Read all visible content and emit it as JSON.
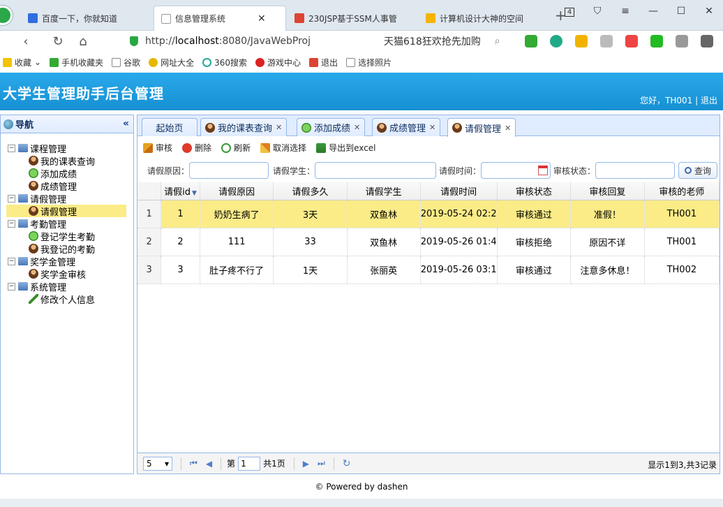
{
  "browser": {
    "tabs": [
      {
        "label": "百度一下，你就知道"
      },
      {
        "label": "信息管理系统"
      },
      {
        "label": "230JSP基于SSM人事管"
      },
      {
        "label": "计算机设计大神的空间"
      }
    ],
    "tab_count": "4",
    "url_prefix": "http://",
    "url_host": "localhost",
    "url_rest": ":8080/JavaWebProj",
    "search_text": "天猫618狂欢抢先加购",
    "bookmarks": [
      {
        "label": "收藏"
      },
      {
        "label": "手机收藏夹"
      },
      {
        "label": "谷歌"
      },
      {
        "label": "网址大全"
      },
      {
        "label": "360搜索"
      },
      {
        "label": "游戏中心"
      },
      {
        "label": "退出"
      },
      {
        "label": "选择照片"
      }
    ]
  },
  "header": {
    "title": "大学生管理助手后台管理",
    "welcome": "您好，TH001 | 退出"
  },
  "nav": {
    "title": "导航",
    "groups": [
      {
        "label": "课程管理",
        "children": [
          {
            "label": "我的课表查询"
          },
          {
            "label": "添加成绩"
          },
          {
            "label": "成绩管理"
          }
        ]
      },
      {
        "label": "请假管理",
        "children": [
          {
            "label": "请假管理"
          }
        ]
      },
      {
        "label": "考勤管理",
        "children": [
          {
            "label": "登记学生考勤"
          },
          {
            "label": "我登记的考勤"
          }
        ]
      },
      {
        "label": "奖学金管理",
        "children": [
          {
            "label": "奖学金审核"
          }
        ]
      },
      {
        "label": "系统管理",
        "children": [
          {
            "label": "修改个人信息"
          }
        ]
      }
    ]
  },
  "tabs": [
    {
      "label": "起始页"
    },
    {
      "label": "我的课表查询"
    },
    {
      "label": "添加成绩"
    },
    {
      "label": "成绩管理"
    },
    {
      "label": "请假管理"
    }
  ],
  "toolbar": {
    "audit": "审核",
    "delete": "删除",
    "refresh": "刷新",
    "unselect": "取消选择",
    "export": "导出到excel"
  },
  "filters": {
    "reason_label": "请假原因：",
    "student_label": "请假学生：",
    "time_label": "请假时间：",
    "status_label": "审核状态：",
    "query_button": "查询"
  },
  "grid": {
    "columns": [
      "请假id",
      "请假原因",
      "请假多久",
      "请假学生",
      "请假时间",
      "审核状态",
      "审核回复",
      "审核的老师"
    ],
    "rows": [
      {
        "rn": "1",
        "id": "1",
        "reason": "奶奶生病了",
        "duration": "3天",
        "student": "双鱼林",
        "time": "2019-05-24 02:2",
        "status": "审核通过",
        "reply": "准假！",
        "teacher": "TH001"
      },
      {
        "rn": "2",
        "id": "2",
        "reason": "111",
        "duration": "33",
        "student": "双鱼林",
        "time": "2019-05-26 01:4",
        "status": "审核拒绝",
        "reply": "原因不详",
        "teacher": "TH001"
      },
      {
        "rn": "3",
        "id": "3",
        "reason": "肚子疼不行了",
        "duration": "1天",
        "student": "张丽英",
        "time": "2019-05-26 03:1",
        "status": "审核通过",
        "reply": "注意多休息！",
        "teacher": "TH002"
      }
    ]
  },
  "pager": {
    "page_size": "5",
    "page_prefix": "第",
    "page_value": "1",
    "page_suffix": "共1页",
    "info": "显示1到3,共3记录"
  },
  "footer": "© Powered by dashen"
}
